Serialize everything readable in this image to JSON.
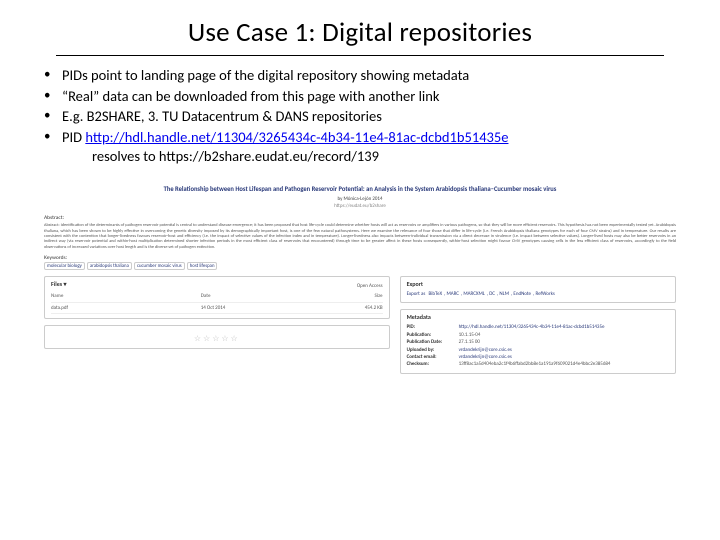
{
  "title": "Use Case 1: Digital repositories",
  "bullets": {
    "b1": "PIDs point to landing page of the digital repository showing metadata",
    "b2": "“Real” data can be downloaded from this page with another link",
    "b3": "E.g. B2SHARE, 3. TU Datacentrum & DANS repositories",
    "b4_prefix": "PID ",
    "b4_link": "http://hdl.handle.net/11304/3265434c-4b34-11e4-81ac-dcbd1b51435e",
    "b4_resolves": "resolves to https://b2share.eudat.eu/record/139"
  },
  "record": {
    "title": "The Relationship between Host Lifespan and Pathogen Reservoir Potential: an Analysis in the System Arabidopsis thaliana–Cucumber mosaic virus",
    "by_pre": "by",
    "by": "Mónica-Lejón 2014",
    "resolved": "https://eudat.eu/b2share",
    "abs_label": "Abstract:",
    "abstract": "Abstract: Identification of the determinants of pathogen reservoir potential is central to understand disease emergence; it has been proposed that host life-cycle could determine whether hosts will act as reservoirs or amplifiers in various pathogens, so that they will be more efficient reservoirs. This hypothesis has not been experimentally tested yet. Arabidopsis thaliana, which has been shown to be highly effective in overcoming the genetic diversity imposed by its demographically important host, is one of the few natural pathosystems. Here we examine the relevance of four those that differ in life-cycle (i.e. French Arabidopsis thaliana genotypes for each of four CMV strains) and in temperature. Our results are consistent with the contention that longer-livedness favours reservoir-host and efficiency (i.e. the impact of selective values of the infection index and in temperature). Longer-livedness also impacts between-individual transmission via a direct decrease in virulence (i.e. impact between selective values). Longer-lived hosts may also be better reservoirs in an indirect way (via reservoir potential and within-host multiplication determined shorter infection periods in the most efficient class of reservoirs that encountered) through time to be greater affect in these hosts consequently, within-host selection might favour CMV genotypes causing cells in the less efficient class of reservoirs, accordingly to the field observations of increased variations over host length and is the diverse set of pathogen extinction.",
    "kw_label": "Keywords:",
    "keywords": [
      "molecular biology",
      "arabidopsis thaliana",
      "cucumber mosaic virus",
      "host lifespan"
    ],
    "files": {
      "head": "Files ▾",
      "open": "Open Access",
      "cols": {
        "name": "Name",
        "date": "Date",
        "size": "Size"
      },
      "row": {
        "name": "data.pdf",
        "date": "14 Oct 2014",
        "size": "454.2 KB"
      }
    },
    "rating_stars": "☆☆☆☆☆",
    "export": {
      "head": "Export",
      "pre": "Export as",
      "formats": [
        "BibTeX",
        "MARC",
        "MARCXML",
        "DC",
        "NLM",
        "EndNote",
        "RefWorks"
      ]
    },
    "meta": {
      "head": "Metadata",
      "pid_k": "PID:",
      "pid_v": "http://hdl.handle.net/11304/3265434c-4b34-11e4-81ac-dcbd1b51435e",
      "pub_k": "Publication:",
      "pub_v": "10.1.15-04",
      "pubdate_k": "Publication Date:",
      "pubdate_v": "27.1.15 00",
      "up_k": "Uploaded by:",
      "up_v": "vrdandekrijn@core.csic.es",
      "mail_k": "Contact email:",
      "mail_v": "vrdandekrijn@core.csic.es",
      "chk_k": "Checksum:",
      "chk_v": "13ff8ac1a5d404eba2c1f4b6ffabd2bb8e1a191a9f609021d4e4bbc2e385684"
    }
  }
}
